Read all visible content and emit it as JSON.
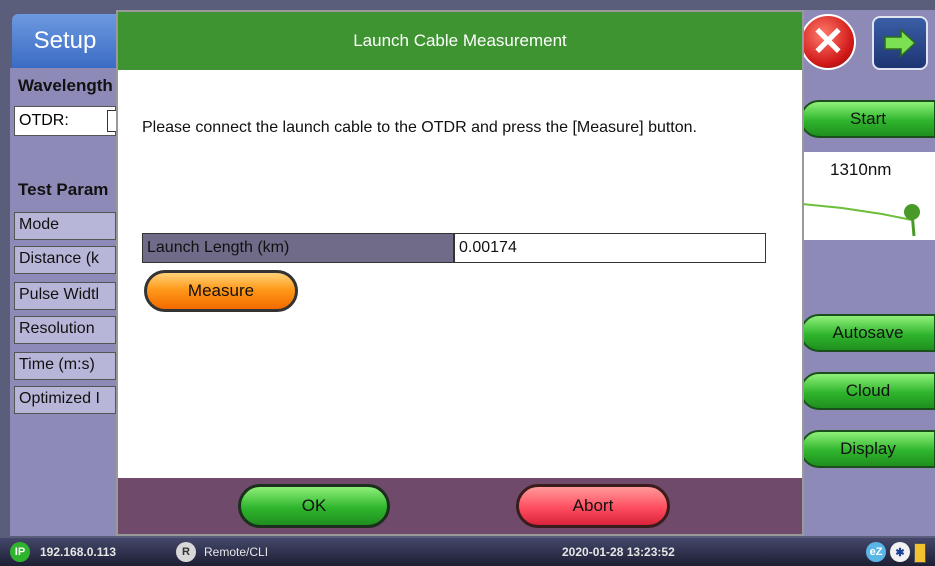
{
  "setup": {
    "tab_label": "Setup",
    "wavelength_label": "Wavelength",
    "otdr_label": "OTDR:",
    "test_params_label": "Test Param",
    "rows": [
      "Mode",
      "Distance (k",
      "Pulse Widtl",
      "Resolution",
      "Time (m:s)",
      "Optimized I"
    ]
  },
  "right": {
    "start_label": "Start",
    "trace_wavelength": "1310nm",
    "autosave_label": "Autosave",
    "cloud_label": "Cloud",
    "display_label": "Display"
  },
  "dialog": {
    "title": "Launch Cable Measurement",
    "message": "Please connect the launch cable to the OTDR and press the [Measure] button.",
    "launch_length_label": "Launch Length (km)",
    "launch_length_value": "0.00174",
    "measure_label": "Measure",
    "ok_label": "OK",
    "abort_label": "Abort"
  },
  "status": {
    "ip_badge": "IP",
    "ip_address": "192.168.0.113",
    "remote_badge": "R",
    "remote_label": "Remote/CLI",
    "datetime": "2020-01-28  13:23:52"
  },
  "colors": {
    "title_green": "#3d9430",
    "footer": "#6f4a6a",
    "panel": "#8e8ab8"
  }
}
